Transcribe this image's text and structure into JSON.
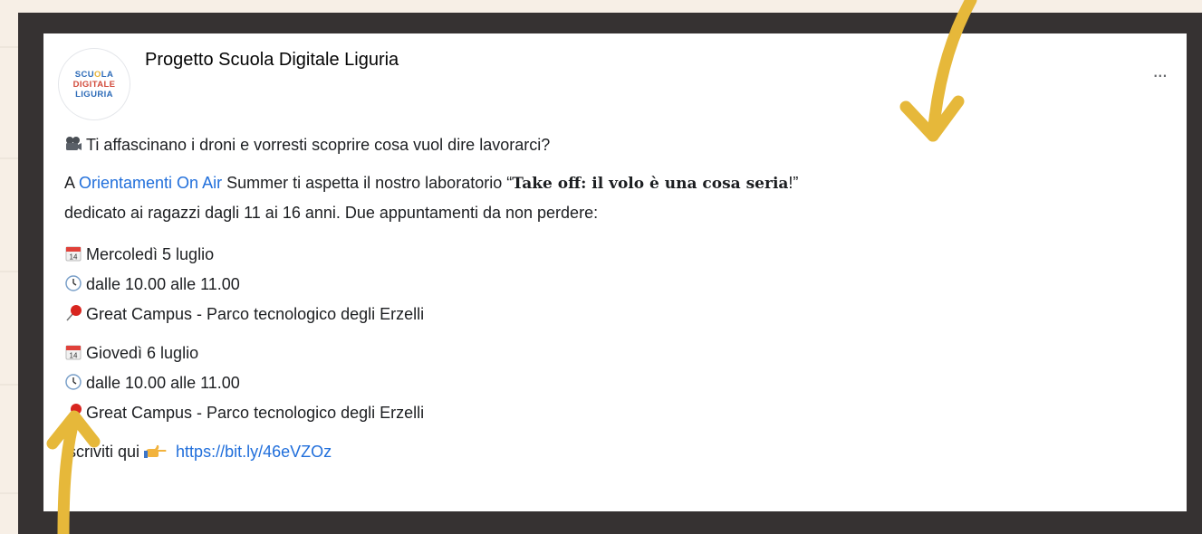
{
  "post": {
    "page_name": "Progetto Scuola Digitale Liguria",
    "avatar": {
      "line1": [
        "SCU",
        "O",
        "LA"
      ],
      "line2": "DIGITALE",
      "line3": "LIGURIA"
    },
    "more_label": "...",
    "intro": "Ti affascinano i droni e vorresti scoprire cosa vuol dire lavorarci?",
    "para_prefix": "A ",
    "para_link": "Orientamenti On Air",
    "para_mid": "  Summer ti aspetta il nostro laboratorio “",
    "para_bold": "Take off: il volo è una cosa seria",
    "para_end": "!”",
    "para_line2": "dedicato ai ragazzi dagli 11 ai 16 anni. Due appuntamenti da non perdere:",
    "events": [
      {
        "date": "Mercoledì 5 luglio",
        "time": "dalle 10.00 alle 11.00",
        "place": "Great Campus - Parco tecnologico degli Erzelli"
      },
      {
        "date": "Giovedì 6 luglio",
        "time": "dalle 10.00 alle 11.00",
        "place": "Great Campus - Parco tecnologico degli Erzelli"
      }
    ],
    "signup_label": "scriviti qui",
    "signup_link": "https://bit.ly/46eVZOz",
    "calendar_day": "14"
  },
  "colors": {
    "frame": "#363232",
    "accent_arrow": "#e6b83a",
    "link": "#216fdb"
  }
}
